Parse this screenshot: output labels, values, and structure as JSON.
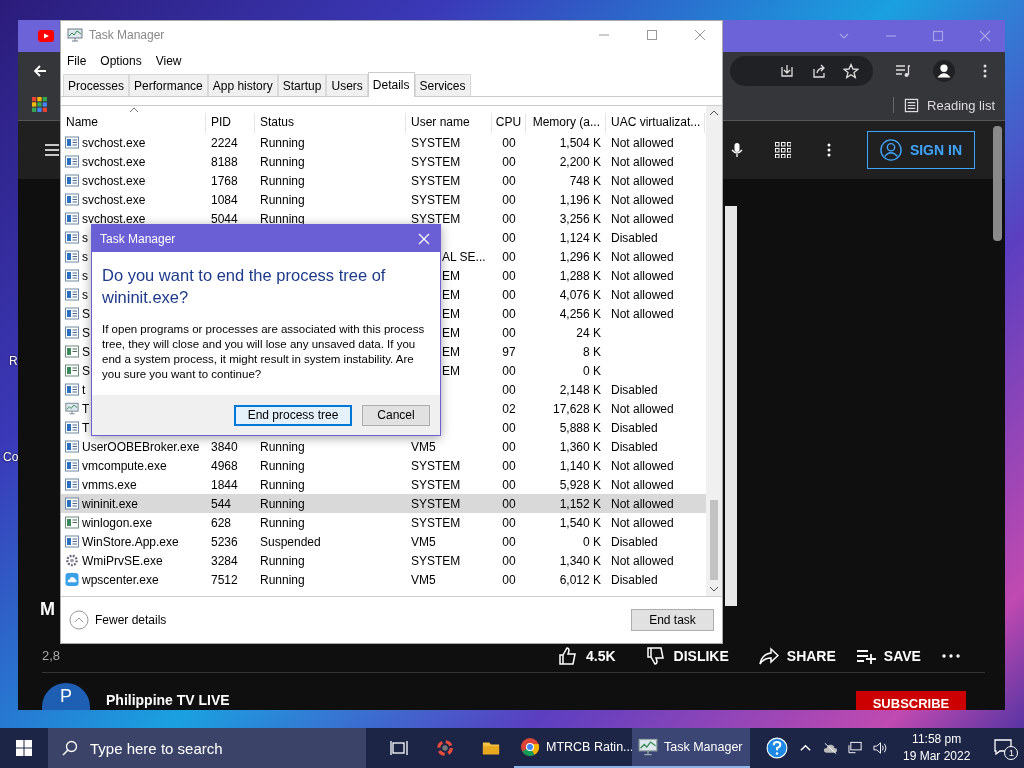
{
  "desktop": {
    "icons": [
      {
        "label": "R"
      },
      {
        "label": "Co"
      }
    ]
  },
  "browser": {
    "reading_list": "Reading list",
    "sign_in": "SIGN IN",
    "video_title": "M",
    "views": "2,8",
    "likes": "4.5K",
    "dislike": "DISLIKE",
    "share": "SHARE",
    "save": "SAVE",
    "channel": {
      "avatar_letter": "P",
      "name": "Philippine TV LIVE"
    },
    "subscribe": "SUBSCRIBE"
  },
  "task_manager": {
    "title": "Task Manager",
    "menu": [
      "File",
      "Options",
      "View"
    ],
    "tabs": [
      {
        "label": "Processes",
        "selected": false
      },
      {
        "label": "Performance",
        "selected": false
      },
      {
        "label": "App history",
        "selected": false
      },
      {
        "label": "Startup",
        "selected": false
      },
      {
        "label": "Users",
        "selected": false
      },
      {
        "label": "Details",
        "selected": true
      },
      {
        "label": "Services",
        "selected": false
      }
    ],
    "columns": [
      "Name",
      "PID",
      "Status",
      "User name",
      "CPU",
      "Memory (a...",
      "UAC virtualizat..."
    ],
    "rows": [
      {
        "kind": "service",
        "name": "svchost.exe",
        "pid": "2224",
        "status": "Running",
        "user": "SYSTEM",
        "cpu": "00",
        "memory": "1,504 K",
        "uac": "Not allowed",
        "selected": false
      },
      {
        "kind": "service",
        "name": "svchost.exe",
        "pid": "8188",
        "status": "Running",
        "user": "SYSTEM",
        "cpu": "00",
        "memory": "2,200 K",
        "uac": "Not allowed",
        "selected": false
      },
      {
        "kind": "service",
        "name": "svchost.exe",
        "pid": "1768",
        "status": "Running",
        "user": "SYSTEM",
        "cpu": "00",
        "memory": "748 K",
        "uac": "Not allowed",
        "selected": false
      },
      {
        "kind": "service",
        "name": "svchost.exe",
        "pid": "1084",
        "status": "Running",
        "user": "SYSTEM",
        "cpu": "00",
        "memory": "1,196 K",
        "uac": "Not allowed",
        "selected": false
      },
      {
        "kind": "service",
        "name": "svchost.exe",
        "pid": "5044",
        "status": "Running",
        "user": "SYSTEM",
        "cpu": "00",
        "memory": "3,256 K",
        "uac": "Not allowed",
        "selected": false
      },
      {
        "kind": "service",
        "name": "s",
        "cpu": "00",
        "memory": "1,124 K",
        "uac": "Disabled",
        "selected": false
      },
      {
        "kind": "service",
        "name": "s",
        "user": "AL SE...",
        "cpu": "00",
        "memory": "1,296 K",
        "uac": "Not allowed",
        "selected": false
      },
      {
        "kind": "service",
        "name": "s",
        "user": "EM",
        "cpu": "00",
        "memory": "1,288 K",
        "uac": "Not allowed",
        "selected": false
      },
      {
        "kind": "service",
        "name": "s",
        "user": "EM",
        "cpu": "00",
        "memory": "4,076 K",
        "uac": "Not allowed",
        "selected": false
      },
      {
        "kind": "service",
        "name": "S",
        "user": "EM",
        "cpu": "00",
        "memory": "4,256 K",
        "uac": "Not allowed",
        "selected": false
      },
      {
        "kind": "service",
        "name": "S",
        "user": "EM",
        "cpu": "00",
        "memory": "24 K",
        "selected": false
      },
      {
        "kind": "app",
        "name": "S",
        "user": "EM",
        "cpu": "97",
        "memory": "8 K",
        "selected": false
      },
      {
        "kind": "app",
        "name": "S",
        "user": "EM",
        "cpu": "00",
        "memory": "0 K",
        "selected": false
      },
      {
        "kind": "service",
        "name": "t",
        "cpu": "00",
        "memory": "2,148 K",
        "uac": "Disabled",
        "selected": false
      },
      {
        "kind": "monitor",
        "name": "T",
        "cpu": "02",
        "memory": "17,628 K",
        "uac": "Not allowed",
        "selected": false
      },
      {
        "kind": "service",
        "name": "T",
        "cpu": "00",
        "memory": "5,888 K",
        "uac": "Disabled",
        "selected": false
      },
      {
        "kind": "service",
        "name": "UserOOBEBroker.exe",
        "pid": "3840",
        "status": "Running",
        "user": "VM5",
        "cpu": "00",
        "memory": "1,360 K",
        "uac": "Disabled",
        "selected": false
      },
      {
        "kind": "service",
        "name": "vmcompute.exe",
        "pid": "4968",
        "status": "Running",
        "user": "SYSTEM",
        "cpu": "00",
        "memory": "1,140 K",
        "uac": "Not allowed",
        "selected": false
      },
      {
        "kind": "service",
        "name": "vmms.exe",
        "pid": "1844",
        "status": "Running",
        "user": "SYSTEM",
        "cpu": "00",
        "memory": "5,928 K",
        "uac": "Not allowed",
        "selected": false
      },
      {
        "kind": "service",
        "name": "wininit.exe",
        "pid": "544",
        "status": "Running",
        "user": "SYSTEM",
        "cpu": "00",
        "memory": "1,152 K",
        "uac": "Not allowed",
        "selected": true
      },
      {
        "kind": "app",
        "name": "winlogon.exe",
        "pid": "628",
        "status": "Running",
        "user": "SYSTEM",
        "cpu": "00",
        "memory": "1,540 K",
        "uac": "Not allowed",
        "selected": false
      },
      {
        "kind": "service",
        "name": "WinStore.App.exe",
        "pid": "5236",
        "status": "Suspended",
        "user": "VM5",
        "cpu": "00",
        "memory": "0 K",
        "uac": "Disabled",
        "selected": false
      },
      {
        "kind": "gear",
        "name": "WmiPrvSE.exe",
        "pid": "3284",
        "status": "Running",
        "user": "SYSTEM",
        "cpu": "00",
        "memory": "1,340 K",
        "uac": "Not allowed",
        "selected": false
      },
      {
        "kind": "cloud",
        "name": "wpscenter.exe",
        "pid": "7512",
        "status": "Running",
        "user": "VM5",
        "cpu": "00",
        "memory": "6,012 K",
        "uac": "Disabled",
        "selected": false
      }
    ],
    "fewer_details": "Fewer details",
    "end_task": "End task"
  },
  "dialog": {
    "title": "Task Manager",
    "heading": "Do you want to end the process tree of wininit.exe?",
    "body": "If open programs or processes are associated with this process tree, they will close and you will lose any unsaved data. If you end a system process, it might result in system instability. Are you sure you want to continue?",
    "buttons": [
      {
        "label": "End process tree",
        "default": true
      },
      {
        "label": "Cancel",
        "default": false
      }
    ]
  },
  "taskbar": {
    "search_placeholder": "Type here to search",
    "apps": [
      {
        "label": "MTRCB Ratin...",
        "active": false
      },
      {
        "label": "Task Manager",
        "active": true
      }
    ],
    "time": "11:58 pm",
    "date": "19 Mar 2022",
    "notification_count": "1"
  }
}
